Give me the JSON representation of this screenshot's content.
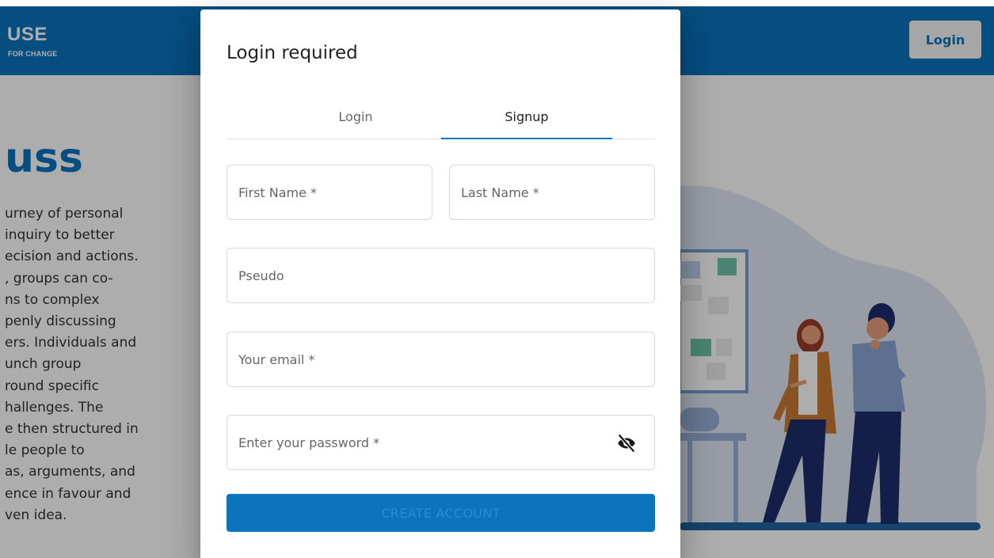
{
  "header": {
    "logo_text": "USE",
    "logo_tagline": "FOR CHANGE",
    "login_label": "Login"
  },
  "hero": {
    "title": "uss",
    "lines": [
      "urney of personal",
      " inquiry to better",
      "ecision and actions.",
      ", groups can co-",
      "ns to complex",
      "penly discussing",
      "ers. Individuals and",
      "unch group",
      "round specific",
      "hallenges. The",
      "e then structured in",
      "le people to",
      "as, arguments, and",
      "ence in favour and",
      "ven idea."
    ]
  },
  "modal": {
    "title": "Login required",
    "tabs": [
      {
        "label": "Login",
        "active": false
      },
      {
        "label": "Signup",
        "active": true
      }
    ],
    "fields": {
      "first_name": {
        "placeholder": "First Name *",
        "value": ""
      },
      "last_name": {
        "placeholder": "Last Name *",
        "value": ""
      },
      "pseudo": {
        "placeholder": "Pseudo",
        "value": ""
      },
      "email": {
        "placeholder": "Your email *",
        "value": ""
      },
      "password": {
        "placeholder": "Enter your password *",
        "value": "",
        "toggle_icon": "eye-off-icon"
      }
    },
    "submit_label": "CREATE ACCOUNT"
  },
  "colors": {
    "brand": "#0a74bd",
    "overlay": "rgba(0,0,0,0.32)",
    "text": "#222222"
  }
}
